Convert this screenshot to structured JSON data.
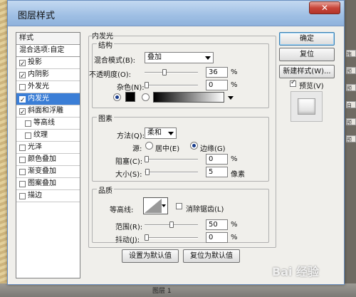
{
  "dialog_title": "图层样式",
  "close_glyph": "✕",
  "left_panel": {
    "header": "样式",
    "blend_options": "混合选项:自定",
    "items": [
      {
        "label": "投影",
        "checked": true
      },
      {
        "label": "内阴影",
        "checked": true
      },
      {
        "label": "外发光",
        "checked": false
      },
      {
        "label": "内发光",
        "checked": true,
        "selected": true
      },
      {
        "label": "斜面和浮雕",
        "checked": true
      },
      {
        "label": "等高线",
        "checked": false,
        "sub": true
      },
      {
        "label": "纹理",
        "checked": false,
        "sub": true
      },
      {
        "label": "光泽",
        "checked": false
      },
      {
        "label": "颜色叠加",
        "checked": false
      },
      {
        "label": "渐变叠加",
        "checked": false
      },
      {
        "label": "图案叠加",
        "checked": false
      },
      {
        "label": "描边",
        "checked": false
      }
    ]
  },
  "inner_glow": {
    "title": "内发光",
    "structure": {
      "title": "结构",
      "blend_mode_label": "混合模式(B):",
      "blend_mode_value": "叠加",
      "opacity_label": "不透明度(O):",
      "opacity_value": "36",
      "opacity_fraction": 0.36,
      "noise_label": "杂色(N):",
      "noise_value": "0",
      "noise_fraction": 0.0,
      "percent": "%"
    },
    "elements": {
      "title": "图素",
      "method_label": "方法(Q):",
      "method_value": "柔和",
      "source_label": "源:",
      "source_center": "居中(E)",
      "source_edge": "边缘(G)",
      "choke_label": "阻塞(C):",
      "choke_value": "0",
      "choke_fraction": 0.0,
      "size_label": "大小(S):",
      "size_value": "5",
      "size_fraction": 0.02,
      "percent": "%",
      "pixels": "像素"
    },
    "quality": {
      "title": "品质",
      "contour_label": "等高线:",
      "antialias_label": "消除锯齿(L)",
      "range_label": "范围(R):",
      "range_value": "50",
      "range_fraction": 0.5,
      "jitter_label": "抖动(J):",
      "jitter_value": "0",
      "jitter_fraction": 0.0,
      "percent": "%"
    },
    "set_default": "设置为默认值",
    "reset_default": "复位为默认值"
  },
  "right_buttons": {
    "ok": "确定",
    "reset": "复位",
    "new_style": "新建样式(W)...",
    "preview_label": "预览(V)",
    "preview_checked": true
  },
  "background": {
    "right_strip": [
      "拖",
      "预设",
      "预",
      "自",
      "预设",
      "预设"
    ],
    "bottom_text": "图层 1",
    "watermark": "Bai 经验"
  },
  "colors": {
    "selection": "#3b7ed6",
    "title_bar": "#9fbfe4",
    "close": "#c8463a",
    "glow_swatch": "#000000"
  }
}
